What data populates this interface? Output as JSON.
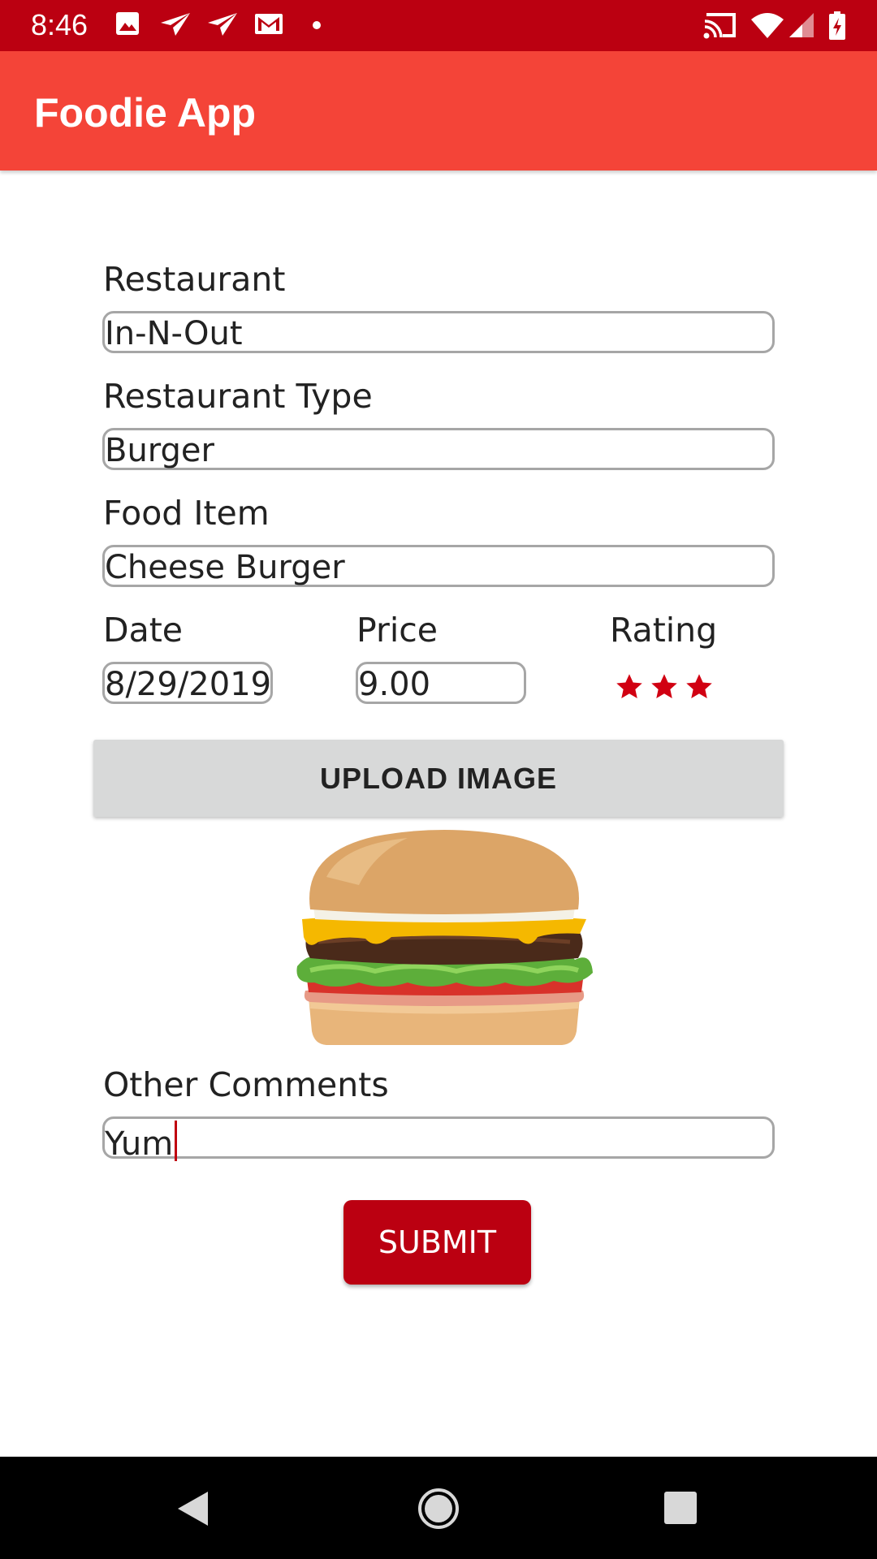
{
  "status_bar": {
    "time": "8:46",
    "left_icons": [
      "image-icon",
      "send-icon",
      "send-icon",
      "gmail-icon",
      "dot-icon"
    ],
    "right_icons": [
      "cast-icon",
      "wifi-icon",
      "signal-icon",
      "battery-charging-icon"
    ],
    "background": "#bb0011"
  },
  "app_bar": {
    "title": "Foodie App",
    "background": "#f44438"
  },
  "form": {
    "restaurant": {
      "label": "Restaurant",
      "value": "In-N-Out"
    },
    "restaurant_type": {
      "label": "Restaurant Type",
      "value": "Burger"
    },
    "food_item": {
      "label": "Food Item",
      "value": "Cheese Burger"
    },
    "date": {
      "label": "Date",
      "value": "8/29/2019"
    },
    "price": {
      "label": "Price",
      "value": "9.00"
    },
    "rating": {
      "label": "Rating",
      "stars": 3,
      "star_color": "#d10012"
    },
    "upload_button": "UPLOAD IMAGE",
    "image": "burger-photo",
    "comments": {
      "label": "Other Comments",
      "value": "Yum"
    },
    "submit_button": "SUBMIT",
    "accent": "#bb0011"
  },
  "nav_bar": {
    "buttons": [
      "back-icon",
      "home-icon",
      "recents-icon"
    ]
  }
}
